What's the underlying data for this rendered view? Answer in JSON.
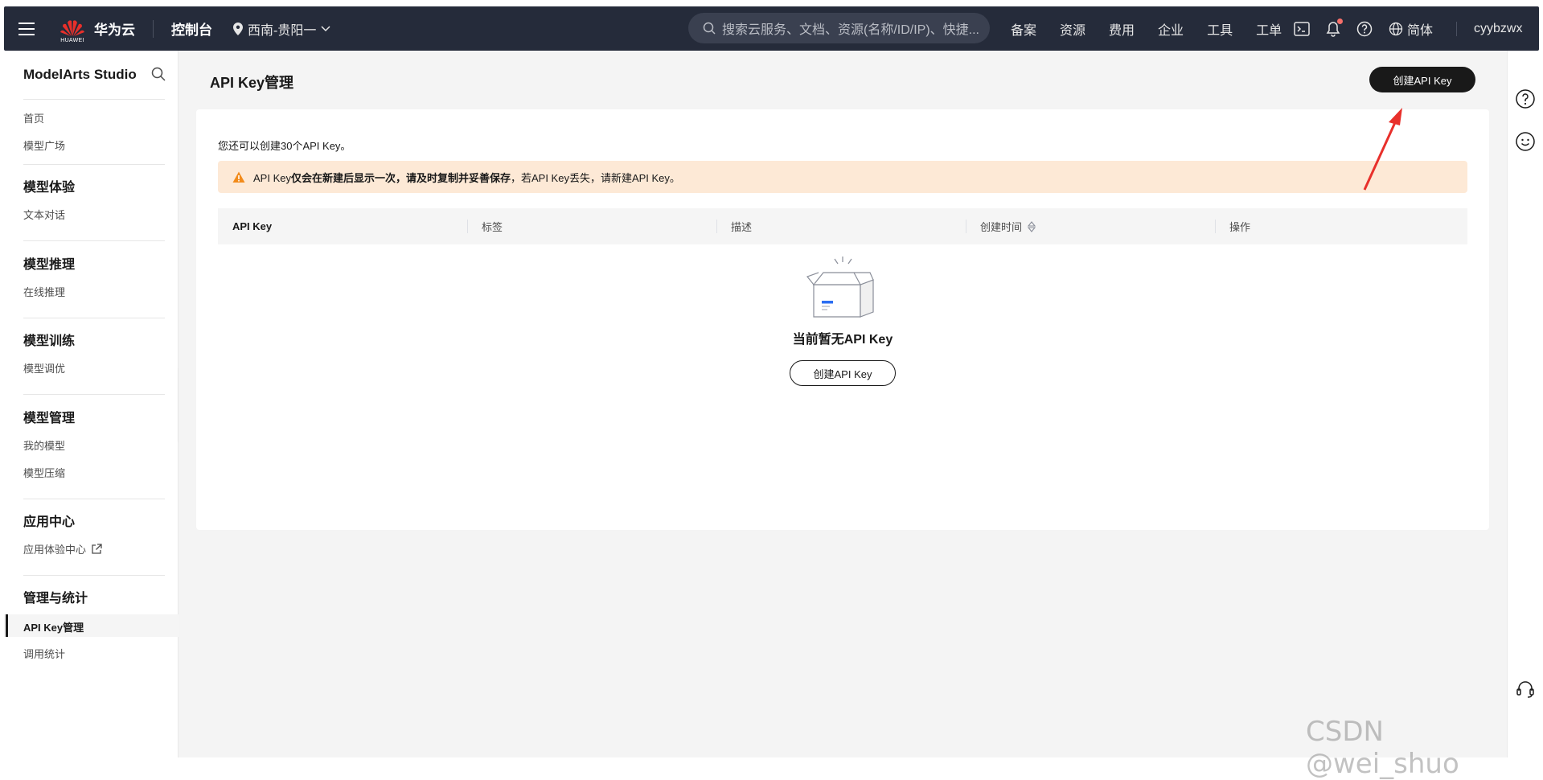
{
  "topbar": {
    "brand": "华为云",
    "brand_small": "HUAWEI",
    "console": "控制台",
    "region": "西南-贵阳一",
    "search_placeholder": "搜索云服务、文档、资源(名称/ID/IP)、快捷...",
    "nav": [
      "备案",
      "资源",
      "费用",
      "企业",
      "工具",
      "工单"
    ],
    "lang": "简体",
    "user": "cyybzwx",
    "notification_dot_color": "#f66f6a"
  },
  "sidebar": {
    "title": "ModelArts Studio",
    "home": "首页",
    "model_square": "模型广场",
    "groups": [
      {
        "title": "模型体验",
        "items": [
          "文本对话"
        ]
      },
      {
        "title": "模型推理",
        "items": [
          "在线推理"
        ]
      },
      {
        "title": "模型训练",
        "items": [
          "模型调优"
        ]
      },
      {
        "title": "模型管理",
        "items": [
          "我的模型",
          "模型压缩"
        ]
      },
      {
        "title": "应用中心",
        "items": [
          "应用体验中心"
        ]
      },
      {
        "title": "管理与统计",
        "items": [
          "API Key管理",
          "调用统计"
        ]
      }
    ]
  },
  "main": {
    "page_title": "API Key管理",
    "create_button": "创建API Key",
    "quota_text": "您还可以创建30个API Key。",
    "warning": {
      "prefix": "API Key",
      "bold": "仅会在新建后显示一次，请及时复制并妥善保存",
      "suffix": "，若API Key丢失，请新建API Key。"
    },
    "table_headers": [
      "API Key",
      "标签",
      "描述",
      "创建时间",
      "操作"
    ],
    "empty_text": "当前暂无API Key",
    "empty_button": "创建API Key"
  },
  "watermark": "CSDN @wei_shuo",
  "colors": {
    "topbar_bg": "#252b3a",
    "primary_button": "#191919",
    "warning_bg": "#fde9d6",
    "warning_icon": "#f28b1b",
    "annotation_arrow": "#e8302b"
  }
}
